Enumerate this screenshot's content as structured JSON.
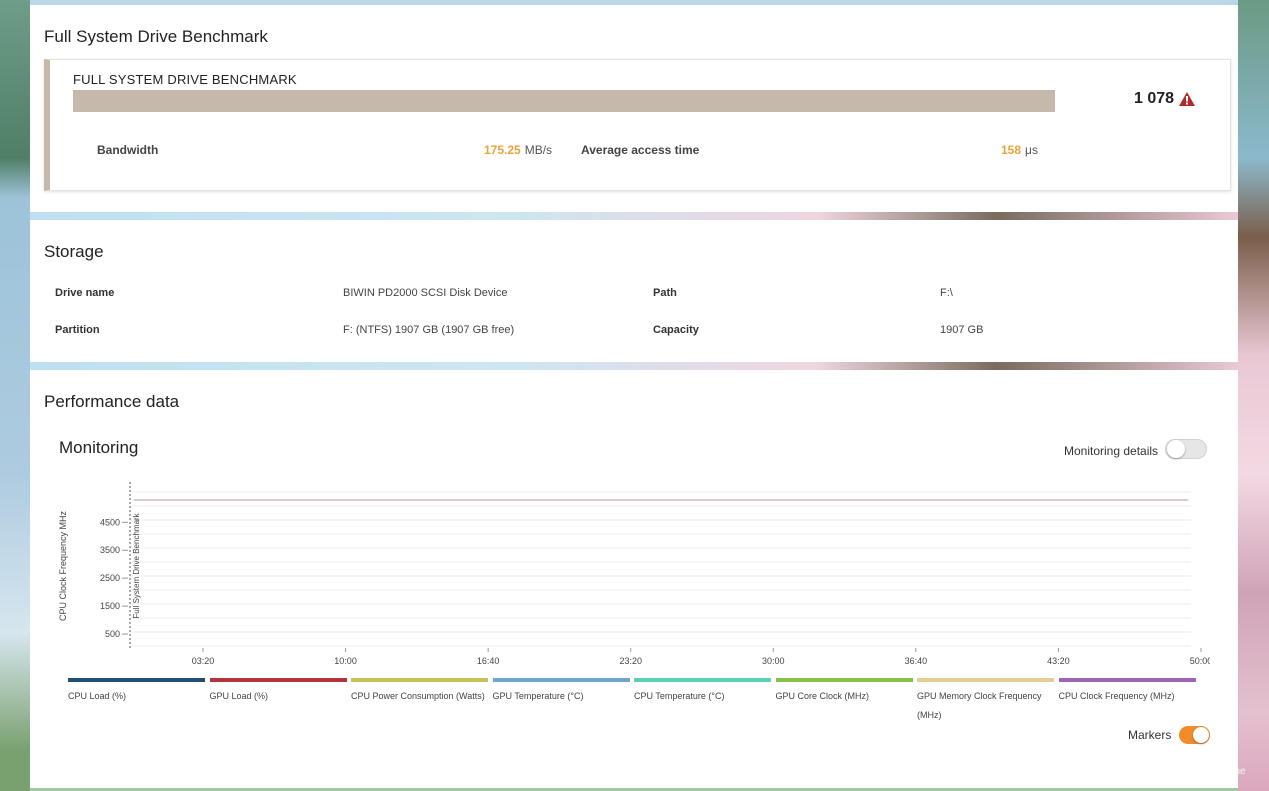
{
  "benchmark": {
    "section_title": "Full System Drive Benchmark",
    "card_label": "FULL SYSTEM DRIVE BENCHMARK",
    "score": "1 078",
    "bar_fill": 1.0,
    "bandwidth": {
      "label": "Bandwidth",
      "value": "175.25",
      "unit": "MB/s"
    },
    "access_time": {
      "label": "Average access time",
      "value": "158",
      "unit": "μs"
    },
    "colors": {
      "bar": "#c5b9ab",
      "value": "#e8a23a",
      "warning": "#b32a2a"
    }
  },
  "storage": {
    "section_title": "Storage",
    "drive_name": {
      "label": "Drive name",
      "value": "BIWIN PD2000 SCSI Disk Device"
    },
    "path": {
      "label": "Path",
      "value": "F:\\"
    },
    "partition": {
      "label": "Partition",
      "value": "F: (NTFS) 1907 GB (1907 GB free)"
    },
    "capacity": {
      "label": "Capacity",
      "value": "1907 GB"
    }
  },
  "performance": {
    "section_title": "Performance data",
    "monitoring_title": "Monitoring",
    "monitoring_details_label": "Monitoring details",
    "monitoring_details_on": false,
    "markers_label": "Markers",
    "markers_on": true
  },
  "chart_data": {
    "type": "line",
    "ylabel": "CPU Clock Frequency MHz",
    "marker_label": "Full System Drive Benchmark",
    "yticks": [
      "4500",
      "3500",
      "2500",
      "1500",
      "500"
    ],
    "xticks": [
      "03:20",
      "10:00",
      "16:40",
      "23:20",
      "30:00",
      "36:40",
      "43:20",
      "50:00"
    ],
    "series": [
      {
        "name": "CPU Clock Frequency (MHz)",
        "color": "#c9a9b6",
        "constant_value": 5300,
        "x_end_fraction": 0.97
      }
    ],
    "legend": [
      {
        "label": "CPU Load (%)",
        "color": "#1f4e79"
      },
      {
        "label": "GPU Load (%)",
        "color": "#b5343c"
      },
      {
        "label": "CPU Power Consumption (Watts)",
        "color": "#c8c05a"
      },
      {
        "label": "GPU Temperature (°C)",
        "color": "#6fa6cf"
      },
      {
        "label": "CPU Temperature (°C)",
        "color": "#5ad0b8"
      },
      {
        "label": "GPU Core Clock (MHz)",
        "color": "#84c04a"
      },
      {
        "label": "GPU Memory Clock Frequency (MHz)",
        "color": "#e3cf95"
      },
      {
        "label": "CPU Clock Frequency (MHz)",
        "color": "#9d63b8"
      }
    ]
  },
  "watermark": "PConline"
}
